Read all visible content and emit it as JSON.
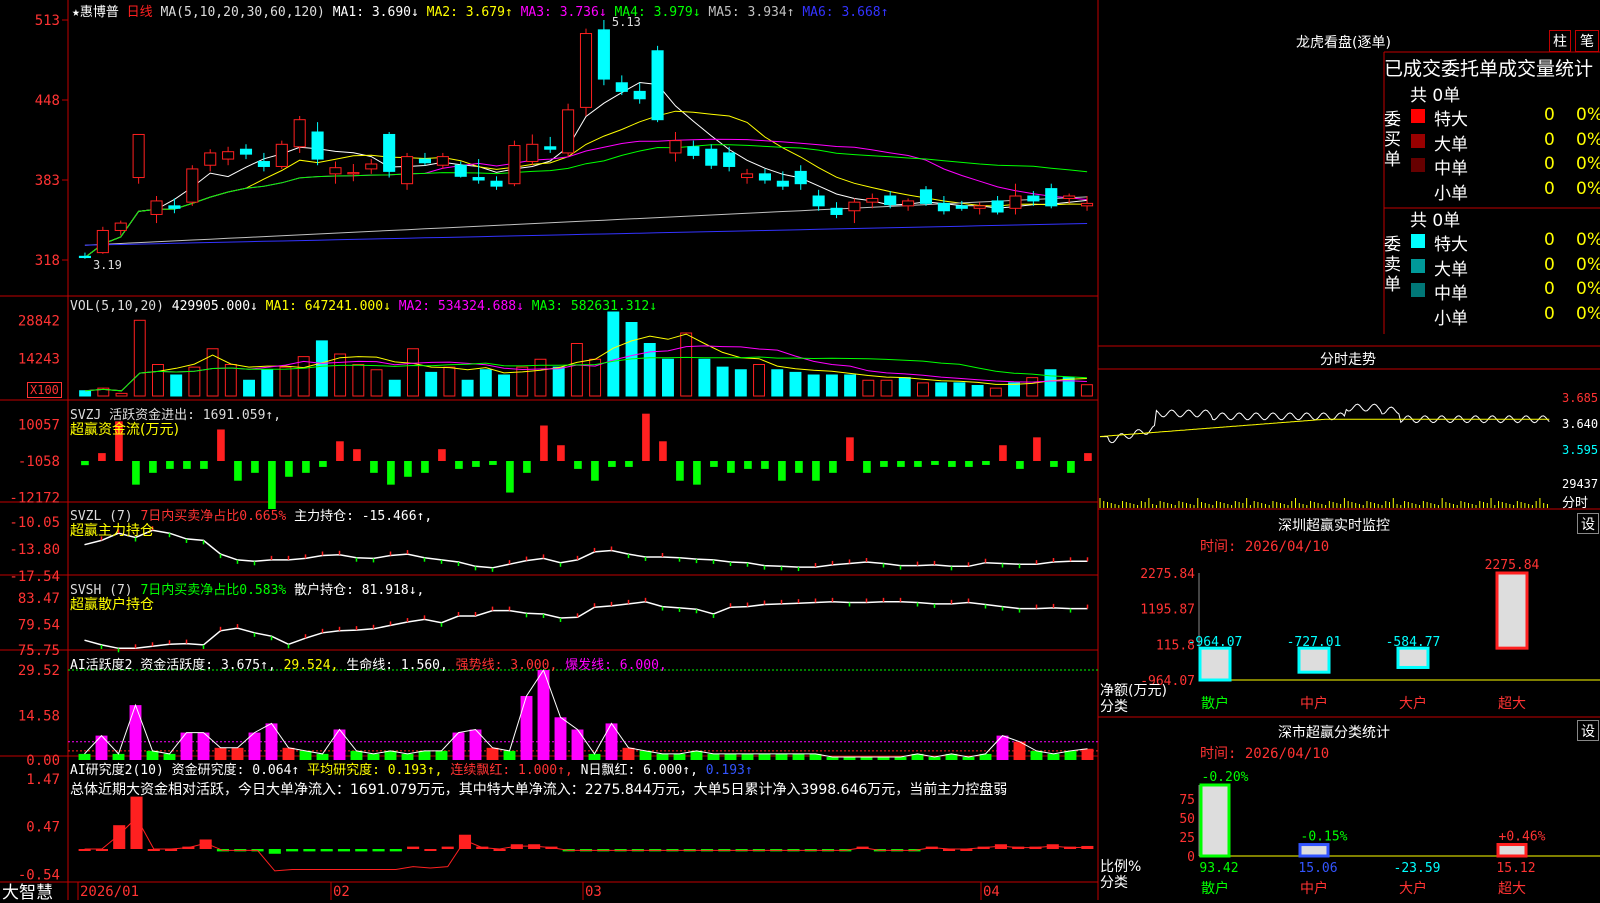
{
  "app": {
    "stock_name": "惠博普",
    "period": "日线",
    "star": "★",
    "brand": "大智慧"
  },
  "colors": {
    "up": "#ff2020",
    "down": "#00ffff",
    "ma1": "#ffffff",
    "ma2": "#ffff00",
    "ma3": "#ff00ff",
    "ma4": "#00ff00",
    "ma5": "#c0c0c0",
    "ma6": "#3333ff",
    "frame": "#c00000",
    "green": "#00ff00",
    "magenta": "#ff00ff"
  },
  "main": {
    "ma_label": "MA(5,10,20,30,60,120)",
    "ma_values": [
      {
        "text": "MA1: 3.690↓",
        "color": "#ffffff"
      },
      {
        "text": "MA2: 3.679↑",
        "color": "#ffff00"
      },
      {
        "text": "MA3: 3.736↓",
        "color": "#ff00ff"
      },
      {
        "text": "MA4: 3.979↓",
        "color": "#00ff00"
      },
      {
        "text": "MA5: 3.934↑",
        "color": "#c0c0c0"
      },
      {
        "text": "MA6: 3.668↑",
        "color": "#3333ff"
      }
    ],
    "y_ticks": [
      "513",
      "448",
      "383",
      "318"
    ],
    "high_label": "5.13",
    "low_label": "3.19"
  },
  "vol": {
    "title": "VOL(5,10,20)",
    "value": "429905.000↓",
    "ma_values": [
      {
        "text": "MA1: 647241.000↓",
        "color": "#ffff00"
      },
      {
        "text": "MA2: 534324.688↓",
        "color": "#ff00ff"
      },
      {
        "text": "MA3: 582631.312↓",
        "color": "#00ff00"
      }
    ],
    "y_ticks": [
      "28842",
      "14243"
    ],
    "unit": "X100"
  },
  "svzj": {
    "title": "SVZJ  活跃资金进出: 1691.059↑,",
    "subtitle": "超赢资金流(万元)",
    "y_ticks": [
      "10057",
      "-1058",
      "-12172"
    ]
  },
  "svzl": {
    "title": "SVZL (7)",
    "ratio": "7日内买卖净占比0.665%",
    "hold": "主力持仓: -15.466↑,",
    "subtitle": "超赢主力持仓",
    "y_ticks": [
      "-10.05",
      "-13.80",
      "-17.54"
    ]
  },
  "svsh": {
    "title": "SVSH (7)",
    "ratio": "7日内买卖净占比0.583%",
    "hold": "散户持仓: 81.918↓,",
    "subtitle": "超赢散户持仓",
    "y_ticks": [
      "83.47",
      "79.54",
      "75.75"
    ]
  },
  "ai_active": {
    "title": "AI活跃度2 资金活跃度: 3.675↑,",
    "v2": "29.524,",
    "life": "生命线: 1.560,",
    "strong": "强势线: 3.000,",
    "burst": "爆发线: 6.000,",
    "y_ticks": [
      "29.52",
      "14.58",
      "0.00"
    ]
  },
  "ai_research": {
    "title": "AI研究度2(10) 资金研究度: 0.064↑",
    "avg": "平均研究度: 0.193↑,",
    "red": "连续飘红: 1.000↑,",
    "nred": "N日飘红: 6.000↑,",
    "last": "0.193↑",
    "summary": "总体近期大资金相对活跃，今日大单净流入：1691.079万元，其中特大单净流入：2275.844万元，大单5日累计净入3998.646万元，当前主力控盘弱",
    "y_ticks": [
      "1.47",
      "0.47",
      "-0.54"
    ]
  },
  "x_axis": [
    "2026/01",
    "02",
    "03",
    "04"
  ],
  "lhb": {
    "title": "龙虎看盘(逐单)",
    "btn_col": "柱",
    "btn_pen": "笔",
    "header": "已成交委托单成交量统计",
    "buy_label": "委买单",
    "sell_label": "委卖单",
    "buy_total": "共 0单",
    "sell_total": "共 0单",
    "buy_rows": [
      {
        "name": "特大",
        "count": "0",
        "pct": "0%",
        "color": "#ff0000"
      },
      {
        "name": "大单",
        "count": "0",
        "pct": "0%",
        "color": "#990000"
      },
      {
        "name": "中单",
        "count": "0",
        "pct": "0%",
        "color": "#660000"
      },
      {
        "name": "小单",
        "count": "0",
        "pct": "0%",
        "color": "#000000"
      }
    ],
    "sell_rows": [
      {
        "name": "特大",
        "count": "0",
        "pct": "0%",
        "color": "#00ffff"
      },
      {
        "name": "大单",
        "count": "0",
        "pct": "0%",
        "color": "#009999"
      },
      {
        "name": "中单",
        "count": "0",
        "pct": "0%",
        "color": "#007777"
      },
      {
        "name": "小单",
        "count": "0",
        "pct": "0%",
        "color": "#000000"
      }
    ]
  },
  "intraday": {
    "title": "分时走势",
    "prices": [
      "3.685",
      "3.640",
      "3.595"
    ],
    "vol_max": "29437",
    "vol_label": "分时"
  },
  "monitor": {
    "title": "深圳超赢实时监控",
    "btn": "设",
    "time": "时间: 2026/04/10",
    "y_ticks": [
      "2275.84",
      "1195.87",
      "115.8",
      "-964.07"
    ],
    "axis_label_1": "净额(万元)",
    "axis_label_2": "分类",
    "bars": [
      {
        "name": "散户",
        "value": -964.07,
        "label": "-964.07"
      },
      {
        "name": "中户",
        "value": -727.01,
        "label": "-727.01"
      },
      {
        "name": "大户",
        "value": -584.77,
        "label": "-584.77"
      },
      {
        "name": "超大",
        "value": 2275.84,
        "label": "2275.84"
      }
    ]
  },
  "classify": {
    "title": "深市超赢分类统计",
    "btn": "设",
    "time": "时间: 2026/04/10",
    "y_ticks": [
      "75",
      "50",
      "25",
      "0"
    ],
    "axis_label_1": "比例%",
    "axis_label_2": "分类",
    "bars": [
      {
        "name": "散户",
        "value": 93.42,
        "label": "93.42",
        "change": "-0.20%",
        "change_color": "#00ff00",
        "label_color": "#00ff00"
      },
      {
        "name": "中户",
        "value": 15.06,
        "label": "15.06",
        "change": "-0.15%",
        "change_color": "#00ff00",
        "label_color": "#3355ff"
      },
      {
        "name": "大户",
        "value": -23.59,
        "label": "-23.59",
        "change": "",
        "change_color": "#00ff00",
        "label_color": "#00ffff"
      },
      {
        "name": "超大",
        "value": 15.12,
        "label": "15.12",
        "change": "+0.46%",
        "change_color": "#ff3333",
        "label_color": "#ff3333"
      }
    ]
  },
  "chart_data": [
    {
      "type": "candlestick",
      "title": "惠博普 日线",
      "ylim": [
        3.18,
        5.13
      ],
      "candles": [
        {
          "o": 3.21,
          "h": 3.24,
          "l": 3.19,
          "c": 3.2
        },
        {
          "o": 3.24,
          "h": 3.45,
          "l": 3.23,
          "c": 3.42
        },
        {
          "o": 3.42,
          "h": 3.5,
          "l": 3.38,
          "c": 3.48
        },
        {
          "o": 3.85,
          "h": 4.2,
          "l": 3.8,
          "c": 4.2
        },
        {
          "o": 3.55,
          "h": 3.7,
          "l": 3.48,
          "c": 3.66
        },
        {
          "o": 3.62,
          "h": 3.68,
          "l": 3.56,
          "c": 3.6
        },
        {
          "o": 3.65,
          "h": 3.95,
          "l": 3.62,
          "c": 3.92
        },
        {
          "o": 3.95,
          "h": 4.08,
          "l": 3.9,
          "c": 4.05
        },
        {
          "o": 4.0,
          "h": 4.1,
          "l": 3.95,
          "c": 4.06
        },
        {
          "o": 4.08,
          "h": 4.12,
          "l": 4.0,
          "c": 4.04
        },
        {
          "o": 3.98,
          "h": 4.05,
          "l": 3.9,
          "c": 3.94
        },
        {
          "o": 3.94,
          "h": 4.15,
          "l": 3.92,
          "c": 4.12
        },
        {
          "o": 4.1,
          "h": 4.35,
          "l": 4.05,
          "c": 4.32
        },
        {
          "o": 4.22,
          "h": 4.3,
          "l": 3.95,
          "c": 4.0
        },
        {
          "o": 3.88,
          "h": 3.98,
          "l": 3.8,
          "c": 3.93
        },
        {
          "o": 3.88,
          "h": 3.96,
          "l": 3.82,
          "c": 3.89
        },
        {
          "o": 3.92,
          "h": 4.0,
          "l": 3.88,
          "c": 3.96
        },
        {
          "o": 4.2,
          "h": 4.22,
          "l": 3.85,
          "c": 3.9
        },
        {
          "o": 3.8,
          "h": 4.05,
          "l": 3.75,
          "c": 4.02
        },
        {
          "o": 4.0,
          "h": 4.05,
          "l": 3.95,
          "c": 3.97
        },
        {
          "o": 3.95,
          "h": 4.05,
          "l": 3.92,
          "c": 4.02
        },
        {
          "o": 3.95,
          "h": 3.98,
          "l": 3.85,
          "c": 3.86
        },
        {
          "o": 3.85,
          "h": 4.0,
          "l": 3.8,
          "c": 3.83
        },
        {
          "o": 3.82,
          "h": 3.86,
          "l": 3.75,
          "c": 3.78
        },
        {
          "o": 3.8,
          "h": 4.15,
          "l": 3.78,
          "c": 4.11
        },
        {
          "o": 3.98,
          "h": 4.2,
          "l": 3.95,
          "c": 4.12
        },
        {
          "o": 4.1,
          "h": 4.18,
          "l": 4.05,
          "c": 4.08
        },
        {
          "o": 4.05,
          "h": 4.45,
          "l": 4.02,
          "c": 4.4
        },
        {
          "o": 4.42,
          "h": 5.06,
          "l": 4.35,
          "c": 5.02
        },
        {
          "o": 5.05,
          "h": 5.13,
          "l": 4.6,
          "c": 4.65
        },
        {
          "o": 4.62,
          "h": 4.68,
          "l": 4.52,
          "c": 4.55
        },
        {
          "o": 4.55,
          "h": 4.62,
          "l": 4.45,
          "c": 4.49
        },
        {
          "o": 4.88,
          "h": 4.92,
          "l": 4.3,
          "c": 4.32
        },
        {
          "o": 4.05,
          "h": 4.22,
          "l": 3.98,
          "c": 4.15
        },
        {
          "o": 4.1,
          "h": 4.15,
          "l": 4.0,
          "c": 4.03
        },
        {
          "o": 4.08,
          "h": 4.12,
          "l": 3.92,
          "c": 3.95
        },
        {
          "o": 4.05,
          "h": 4.1,
          "l": 3.9,
          "c": 3.94
        },
        {
          "o": 3.85,
          "h": 3.92,
          "l": 3.8,
          "c": 3.88
        },
        {
          "o": 3.88,
          "h": 3.92,
          "l": 3.8,
          "c": 3.83
        },
        {
          "o": 3.82,
          "h": 3.9,
          "l": 3.75,
          "c": 3.78
        },
        {
          "o": 3.9,
          "h": 3.95,
          "l": 3.75,
          "c": 3.8
        },
        {
          "o": 3.7,
          "h": 3.75,
          "l": 3.58,
          "c": 3.62
        },
        {
          "o": 3.6,
          "h": 3.65,
          "l": 3.52,
          "c": 3.55
        },
        {
          "o": 3.58,
          "h": 3.68,
          "l": 3.48,
          "c": 3.65
        },
        {
          "o": 3.65,
          "h": 3.72,
          "l": 3.6,
          "c": 3.68
        },
        {
          "o": 3.7,
          "h": 3.74,
          "l": 3.6,
          "c": 3.63
        },
        {
          "o": 3.62,
          "h": 3.68,
          "l": 3.58,
          "c": 3.66
        },
        {
          "o": 3.75,
          "h": 3.78,
          "l": 3.62,
          "c": 3.64
        },
        {
          "o": 3.64,
          "h": 3.7,
          "l": 3.55,
          "c": 3.58
        },
        {
          "o": 3.62,
          "h": 3.66,
          "l": 3.58,
          "c": 3.6
        },
        {
          "o": 3.6,
          "h": 3.65,
          "l": 3.55,
          "c": 3.62
        },
        {
          "o": 3.66,
          "h": 3.7,
          "l": 3.55,
          "c": 3.57
        },
        {
          "o": 3.6,
          "h": 3.8,
          "l": 3.55,
          "c": 3.7
        },
        {
          "o": 3.7,
          "h": 3.74,
          "l": 3.62,
          "c": 3.66
        },
        {
          "o": 3.76,
          "h": 3.8,
          "l": 3.6,
          "c": 3.62
        },
        {
          "o": 3.68,
          "h": 3.72,
          "l": 3.64,
          "c": 3.7
        },
        {
          "o": 3.62,
          "h": 3.7,
          "l": 3.58,
          "c": 3.64
        }
      ]
    },
    {
      "type": "bar",
      "title": "VOL(5,10,20)",
      "values": [
        2000,
        3000,
        1000,
        28842,
        12000,
        8000,
        11000,
        18000,
        12000,
        6000,
        10000,
        11000,
        15000,
        21000,
        16000,
        12000,
        10000,
        6000,
        18000,
        9000,
        11000,
        6000,
        10000,
        8000,
        11000,
        14000,
        11000,
        20000,
        14000,
        32000,
        28000,
        20000,
        14000,
        24000,
        14000,
        11000,
        10000,
        12000,
        10000,
        9000,
        8000,
        8000,
        8000,
        6000,
        6000,
        7000,
        5000,
        5000,
        5000,
        4000,
        3000,
        5000,
        7000,
        10000,
        7000,
        4300
      ]
    },
    {
      "type": "bar",
      "title": "SVZJ",
      "values": [
        -1058,
        2000,
        10057,
        -6000,
        -3000,
        -2000,
        -2000,
        -2000,
        8000,
        -5000,
        -3000,
        -12172,
        -4000,
        -3000,
        -1500,
        5000,
        3000,
        -3000,
        -6000,
        -4000,
        -3000,
        3000,
        -2000,
        -1500,
        -1000,
        -8000,
        -3000,
        9000,
        4000,
        -2000,
        -5000,
        -1500,
        -1500,
        12000,
        5000,
        -5000,
        -6000,
        -1500,
        -3000,
        -2000,
        -2000,
        -5000,
        -3000,
        -5000,
        -3000,
        6000,
        -3000,
        -1500,
        -1500,
        -1500,
        -1000,
        -1500,
        -1500,
        -1000,
        4000,
        -2000,
        6000,
        -1500,
        -3000,
        2000
      ]
    },
    {
      "type": "line",
      "title": "SVZL 超赢主力持仓",
      "values": [
        -13.2,
        -12.6,
        -11.6,
        -12.2,
        -11.2,
        -11.6,
        -12.4,
        -12.6,
        -14.5,
        -15.3,
        -15.5,
        -15.3,
        -15.3,
        -15.1,
        -14.7,
        -14.6,
        -15.0,
        -15.1,
        -14.7,
        -14.5,
        -15.0,
        -15.3,
        -15.6,
        -16.2,
        -16.4,
        -15.9,
        -15.4,
        -15.1,
        -15.7,
        -15.3,
        -14.2,
        -14.0,
        -14.5,
        -14.9,
        -14.9,
        -15.0,
        -15.2,
        -15.3,
        -15.6,
        -15.7,
        -16.1,
        -16.2,
        -16.3,
        -16.3,
        -16.0,
        -15.8,
        -15.6,
        -15.8,
        -16.1,
        -16.1,
        -16.0,
        -16.2,
        -16.2,
        -15.7,
        -15.8,
        -15.9,
        -15.9,
        -15.6,
        -15.5,
        -15.5
      ]
    },
    {
      "type": "line",
      "title": "SVSH 超赢散户持仓",
      "values": [
        77.2,
        76.5,
        76.0,
        76.0,
        76.3,
        76.6,
        76.7,
        76.5,
        78.6,
        79.0,
        78.3,
        77.8,
        76.6,
        77.5,
        78.3,
        78.6,
        78.7,
        78.9,
        79.4,
        79.9,
        80.3,
        79.8,
        80.8,
        80.8,
        81.6,
        81.6,
        81.2,
        81.1,
        80.5,
        80.6,
        82.1,
        82.3,
        82.6,
        82.9,
        82.2,
        82.0,
        81.8,
        81.1,
        82.1,
        82.2,
        82.5,
        82.6,
        82.7,
        82.8,
        82.9,
        82.8,
        82.8,
        82.9,
        82.9,
        82.8,
        82.6,
        82.6,
        82.8,
        82.5,
        82.2,
        81.9,
        81.9,
        82.0,
        81.9,
        81.9
      ]
    },
    {
      "type": "bar",
      "title": "AI活跃度2",
      "values": [
        2,
        8,
        2,
        18,
        3,
        2,
        9,
        9,
        4,
        4,
        9,
        12,
        4,
        3,
        2,
        10,
        3,
        2,
        3,
        2,
        3,
        3,
        9,
        10,
        4,
        3,
        21,
        29.5,
        14,
        10,
        2,
        12,
        4,
        3,
        2,
        2,
        3,
        2,
        2,
        2,
        2,
        2,
        2,
        2,
        1,
        1,
        1,
        1,
        1,
        2,
        1,
        2,
        1,
        2,
        8,
        6,
        3,
        2,
        3,
        3.675
      ]
    },
    {
      "type": "bar",
      "title": "AI研究度2(10)",
      "values": [
        0.0,
        0.0,
        0.5,
        1.1,
        0.0,
        0.0,
        0.05,
        0.2,
        -0.05,
        -0.05,
        -0.05,
        -0.1,
        -0.05,
        -0.05,
        -0.05,
        -0.05,
        -0.05,
        -0.05,
        -0.05,
        0.05,
        0.0,
        0.05,
        0.3,
        0.05,
        0.0,
        0.1,
        0.1,
        0.05,
        -0.05,
        -0.05,
        -0.05,
        -0.05,
        -0.05,
        -0.05,
        -0.05,
        -0.05,
        -0.05,
        -0.05,
        -0.05,
        -0.05,
        -0.05,
        -0.05,
        -0.05,
        -0.05,
        -0.05,
        0.05,
        -0.05,
        -0.05,
        -0.05,
        0.05,
        0.0,
        0.0,
        0.05,
        0.1,
        0.05,
        0.05,
        0.1,
        0.05,
        0.064
      ]
    },
    {
      "type": "bar",
      "title": "深圳超赢实时监控",
      "categories": [
        "散户",
        "中户",
        "大户",
        "超大"
      ],
      "values": [
        -964.07,
        -727.01,
        -584.77,
        2275.84
      ],
      "ylim": [
        -964.07,
        2275.84
      ]
    },
    {
      "type": "bar",
      "title": "深市超赢分类统计",
      "categories": [
        "散户",
        "中户",
        "大户",
        "超大"
      ],
      "values": [
        93.42,
        15.06,
        -23.59,
        15.12
      ]
    }
  ]
}
